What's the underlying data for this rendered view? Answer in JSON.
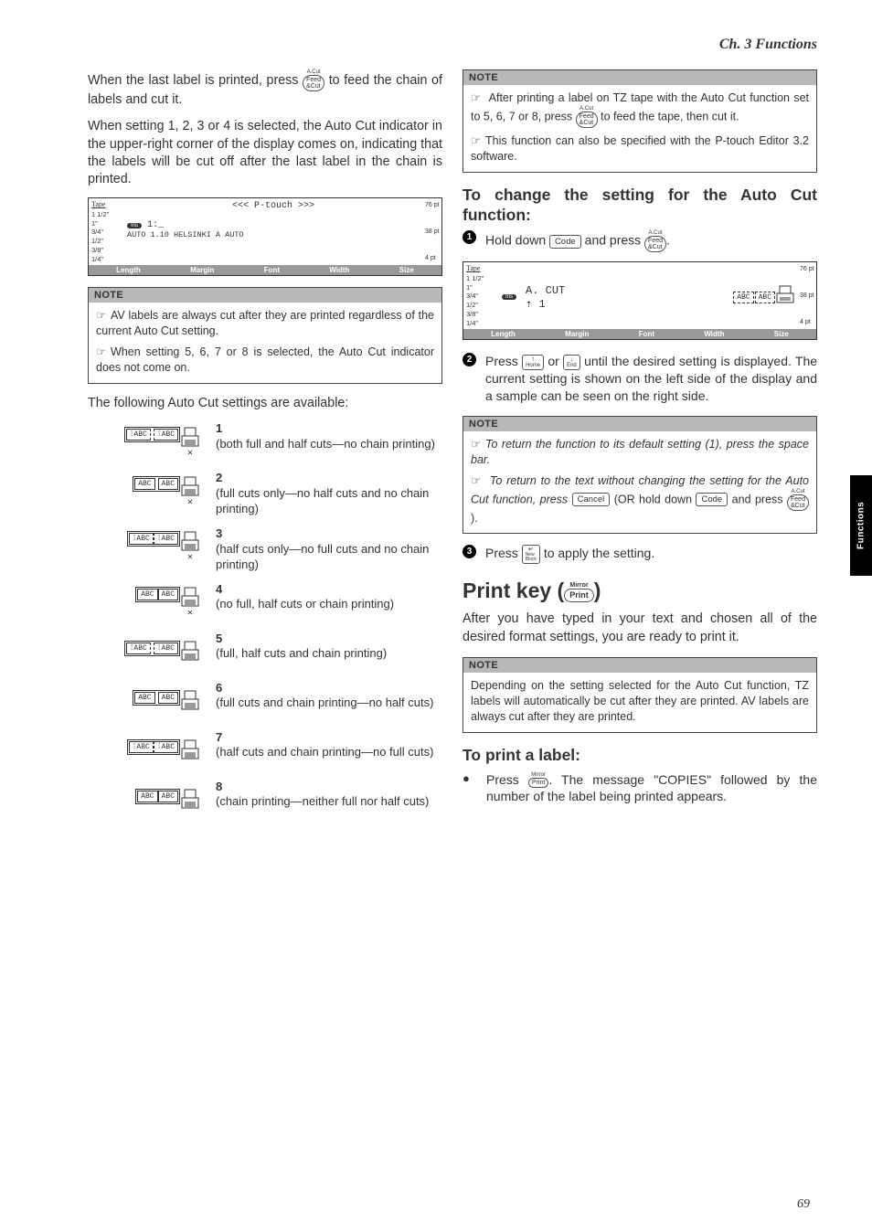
{
  "chapter": "Ch. 3 Functions",
  "side_tab": "Functions",
  "page_number": "69",
  "left": {
    "intro1_a": "When the last label is printed, press ",
    "intro1_b": " to feed the chain of labels and cut it.",
    "intro2": "When setting 1, 2, 3 or 4 is selected, the Auto Cut indicator in the upper-right corner of the display comes on, indicating that the labels will be cut off after the last label in the chain is printed.",
    "display1": {
      "tape_header": "Tape",
      "sizes": [
        "1 1/2\"",
        "1\"",
        "3/4\"",
        "1/2\"",
        "3/8\"",
        "1/4\""
      ],
      "title": "<<< P-touch >>>",
      "line2": "1:_",
      "line3": "AUTO   1.10   HELSINKI     A     AUTO",
      "pts": [
        "76 pt",
        "38 pt",
        "4 pt"
      ],
      "labels": [
        "Length",
        "Margin",
        "Font",
        "Width",
        "Size"
      ]
    },
    "note1_h": "NOTE",
    "note1_a": "AV labels are always cut after they are printed regardless of the current Auto Cut setting.",
    "note1_b": "When setting 5, 6, 7 or 8 is selected, the Auto Cut indicator does not come on.",
    "avail": "The following Auto Cut settings are available:",
    "settings": [
      {
        "num": "1",
        "desc": "(both full and half cuts—no chain printing)",
        "half": true,
        "full": true,
        "chain": false
      },
      {
        "num": "2",
        "desc": "(full cuts only—no half cuts and no chain printing)",
        "half": false,
        "full": true,
        "chain": false
      },
      {
        "num": "3",
        "desc": "(half cuts only—no full cuts and no chain printing)",
        "half": true,
        "full": false,
        "chain": false
      },
      {
        "num": "4",
        "desc": "(no full, half cuts or chain printing)",
        "half": false,
        "full": false,
        "chain": false
      },
      {
        "num": "5",
        "desc": "(full, half cuts and chain printing)",
        "half": true,
        "full": true,
        "chain": true
      },
      {
        "num": "6",
        "desc": "(full cuts and chain printing—no half cuts)",
        "half": false,
        "full": true,
        "chain": true
      },
      {
        "num": "7",
        "desc": "(half cuts and chain printing—no full cuts)",
        "half": true,
        "full": false,
        "chain": true
      },
      {
        "num": "8",
        "desc": "(chain printing—neither full nor half cuts)",
        "half": false,
        "full": false,
        "chain": true
      }
    ]
  },
  "right": {
    "note_top_h": "NOTE",
    "note_top_a_pre": "After printing a label on TZ tape with the Auto Cut function set to 5, 6, 7 or 8, press ",
    "note_top_a_post": " to feed the tape, then cut it.",
    "note_top_b": "This function can also be specified with the P-touch Editor 3.2 software.",
    "h_change": "To change the setting for the Auto Cut function:",
    "step1_a": "Hold down ",
    "step1_b": " and press ",
    "step1_c": ".",
    "display2": {
      "tape_header": "Tape",
      "sizes": [
        "1 1/2\"",
        "1\"",
        "3/4\"",
        "1/2\"",
        "3/8\"",
        "1/4\""
      ],
      "main_a": "A. CUT",
      "main_b": "1",
      "pts": [
        "76 pt",
        "38 pt",
        "4 pt"
      ],
      "labels": [
        "Length",
        "Margin",
        "Font",
        "Width",
        "Size"
      ]
    },
    "step2_a": "Press ",
    "step2_b": " or ",
    "step2_c": " until the desired setting is displayed. The current setting is shown on the left side of the display and a sample can be seen on the right side.",
    "note2_h": "NOTE",
    "note2_a": "To return the function to its default setting (1), press the space bar.",
    "note2_b_pre": "To return to the text without changing the setting for the Auto Cut function, press ",
    "note2_b_mid": " (OR hold down ",
    "note2_b_mid2": " and press ",
    "note2_b_post": " ).",
    "step3_a": "Press ",
    "step3_b": " to apply the setting.",
    "print_h_pre": "Print key (",
    "print_h_post": ")",
    "print_intro": "After you have typed in your text and chosen all of the desired format settings, you are ready to print it.",
    "note3_h": "NOTE",
    "note3_body": "Depending on the setting selected for the Auto Cut function, TZ labels will automatically be cut after they are printed. AV labels are always cut after they are printed.",
    "h_print": "To print a label:",
    "print_step_a": "Press ",
    "print_step_b": ". The message \"COPIES\" followed by the number of the label being printed appears."
  },
  "icon_labels": {
    "acut": "A.Cut",
    "feed": "Feed\n&Cut",
    "code": "Code",
    "home": "Home",
    "end": "End",
    "cancel": "Cancel",
    "new_block": "New\nBlock",
    "mirror": "Mirror",
    "print": "Print",
    "ins": "Ins",
    "abc": "ABC"
  }
}
